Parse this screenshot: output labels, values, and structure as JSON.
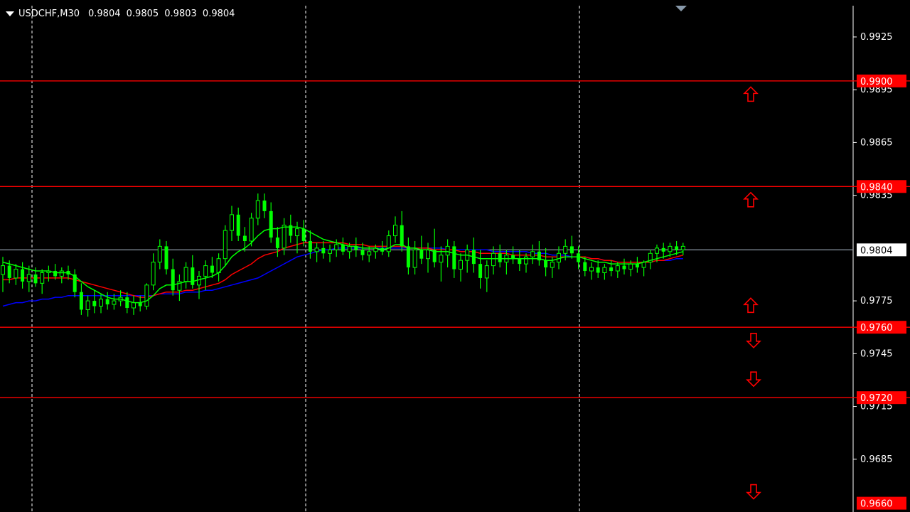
{
  "header": {
    "symbol": "USDCHF,M30",
    "open": "0.9804",
    "high": "0.9805",
    "low": "0.9803",
    "close": "0.9804"
  },
  "chart_data": {
    "type": "candlestick",
    "ylim": [
      0.9655,
      0.9946
    ],
    "price_axis_ticks": [
      "0.9925",
      "0.9895",
      "0.9865",
      "0.9835",
      "0.9775",
      "0.9745",
      "0.9715",
      "0.9685"
    ],
    "current_price": "0.9804",
    "current_price_color": "#ffffff",
    "levels": [
      {
        "price": "0.9900",
        "color": "#ff0000"
      },
      {
        "price": "0.9840",
        "color": "#ff0000"
      },
      {
        "price": "0.9760",
        "color": "#ff0000"
      },
      {
        "price": "0.9720",
        "color": "#ff0000"
      }
    ],
    "bottom_cut_label": "0.9660",
    "arrows": [
      {
        "price": 0.98925,
        "direction": "up"
      },
      {
        "price": 0.98325,
        "direction": "up"
      },
      {
        "price": 0.97725,
        "direction": "up"
      },
      {
        "price": 0.97525,
        "direction": "down"
      },
      {
        "price": 0.97305,
        "direction": "down"
      },
      {
        "price": 0.96665,
        "direction": "down"
      }
    ],
    "candle_color": "#00ff00",
    "ma_colors": {
      "fast": "#00ff00",
      "medium": "#ff0000",
      "slow": "#0000ff"
    },
    "grid": "vertical-dashed",
    "ohlc": [
      [
        0.979,
        0.98,
        0.978,
        0.9795
      ],
      [
        0.9795,
        0.9798,
        0.9785,
        0.9788
      ],
      [
        0.9788,
        0.9796,
        0.9784,
        0.9793
      ],
      [
        0.9793,
        0.9797,
        0.9782,
        0.9786
      ],
      [
        0.9786,
        0.9795,
        0.978,
        0.979
      ],
      [
        0.979,
        0.9794,
        0.9783,
        0.9785
      ],
      [
        0.9785,
        0.9793,
        0.9779,
        0.9791
      ],
      [
        0.9791,
        0.9795,
        0.9786,
        0.9792
      ],
      [
        0.9792,
        0.9796,
        0.9787,
        0.9789
      ],
      [
        0.9789,
        0.9794,
        0.9785,
        0.9792
      ],
      [
        0.9792,
        0.9795,
        0.9787,
        0.979
      ],
      [
        0.979,
        0.9793,
        0.9777,
        0.978
      ],
      [
        0.978,
        0.9785,
        0.9767,
        0.977
      ],
      [
        0.977,
        0.9778,
        0.9766,
        0.9775
      ],
      [
        0.9775,
        0.9781,
        0.9768,
        0.9772
      ],
      [
        0.9772,
        0.9779,
        0.9768,
        0.9776
      ],
      [
        0.9776,
        0.978,
        0.977,
        0.9773
      ],
      [
        0.9773,
        0.9779,
        0.977,
        0.9775
      ],
      [
        0.9775,
        0.9781,
        0.9772,
        0.9777
      ],
      [
        0.9777,
        0.978,
        0.9768,
        0.9771
      ],
      [
        0.9771,
        0.9778,
        0.9767,
        0.9774
      ],
      [
        0.9774,
        0.9778,
        0.9769,
        0.9772
      ],
      [
        0.9772,
        0.9785,
        0.977,
        0.9784
      ],
      [
        0.9784,
        0.9802,
        0.9781,
        0.9797
      ],
      [
        0.9797,
        0.981,
        0.9793,
        0.9806
      ],
      [
        0.9806,
        0.9809,
        0.979,
        0.9793
      ],
      [
        0.9793,
        0.9799,
        0.9778,
        0.9781
      ],
      [
        0.9781,
        0.979,
        0.9775,
        0.9786
      ],
      [
        0.9786,
        0.9797,
        0.9782,
        0.9794
      ],
      [
        0.9794,
        0.9801,
        0.9782,
        0.9784
      ],
      [
        0.9784,
        0.9792,
        0.9776,
        0.9789
      ],
      [
        0.9789,
        0.9798,
        0.9781,
        0.9795
      ],
      [
        0.9795,
        0.98,
        0.9788,
        0.9791
      ],
      [
        0.9791,
        0.9802,
        0.9786,
        0.9799
      ],
      [
        0.9799,
        0.9818,
        0.9795,
        0.9815
      ],
      [
        0.9815,
        0.9829,
        0.9809,
        0.9824
      ],
      [
        0.9824,
        0.9828,
        0.9809,
        0.9812
      ],
      [
        0.9812,
        0.9817,
        0.9803,
        0.9809
      ],
      [
        0.9809,
        0.9825,
        0.9806,
        0.9822
      ],
      [
        0.9822,
        0.9836,
        0.9818,
        0.9832
      ],
      [
        0.9832,
        0.9836,
        0.9822,
        0.9826
      ],
      [
        0.9826,
        0.9831,
        0.9808,
        0.9811
      ],
      [
        0.9811,
        0.9817,
        0.98,
        0.9805
      ],
      [
        0.9805,
        0.9822,
        0.9801,
        0.9818
      ],
      [
        0.9818,
        0.9824,
        0.9808,
        0.9812
      ],
      [
        0.9812,
        0.982,
        0.9802,
        0.9816
      ],
      [
        0.9816,
        0.9821,
        0.9806,
        0.9809
      ],
      [
        0.9809,
        0.9815,
        0.9799,
        0.9803
      ],
      [
        0.9803,
        0.9808,
        0.9797,
        0.9805
      ],
      [
        0.9805,
        0.9809,
        0.9799,
        0.9802
      ],
      [
        0.9802,
        0.9807,
        0.9797,
        0.9804
      ],
      [
        0.9804,
        0.981,
        0.98,
        0.9807
      ],
      [
        0.9807,
        0.9811,
        0.9801,
        0.9803
      ],
      [
        0.9803,
        0.9808,
        0.9799,
        0.9806
      ],
      [
        0.9806,
        0.9811,
        0.98,
        0.9804
      ],
      [
        0.9804,
        0.9808,
        0.9798,
        0.9801
      ],
      [
        0.9801,
        0.9806,
        0.9797,
        0.9803
      ],
      [
        0.9803,
        0.9807,
        0.9799,
        0.9805
      ],
      [
        0.9805,
        0.9809,
        0.9801,
        0.9803
      ],
      [
        0.9803,
        0.9815,
        0.98,
        0.9812
      ],
      [
        0.9812,
        0.9823,
        0.9808,
        0.9818
      ],
      [
        0.9818,
        0.9826,
        0.9803,
        0.9806
      ],
      [
        0.9806,
        0.9811,
        0.979,
        0.9794
      ],
      [
        0.9794,
        0.9809,
        0.979,
        0.9804
      ],
      [
        0.9804,
        0.9812,
        0.9796,
        0.9799
      ],
      [
        0.9799,
        0.9808,
        0.9791,
        0.9804
      ],
      [
        0.9804,
        0.9816,
        0.9794,
        0.9797
      ],
      [
        0.9797,
        0.9806,
        0.9786,
        0.9801
      ],
      [
        0.9801,
        0.981,
        0.9794,
        0.9806
      ],
      [
        0.9806,
        0.9809,
        0.9788,
        0.9793
      ],
      [
        0.9793,
        0.9802,
        0.9786,
        0.9798
      ],
      [
        0.9798,
        0.9807,
        0.9791,
        0.9804
      ],
      [
        0.9804,
        0.9811,
        0.9791,
        0.9796
      ],
      [
        0.9796,
        0.9804,
        0.9782,
        0.9788
      ],
      [
        0.9788,
        0.9798,
        0.978,
        0.9795
      ],
      [
        0.9795,
        0.9806,
        0.979,
        0.9802
      ],
      [
        0.9802,
        0.9807,
        0.9794,
        0.9797
      ],
      [
        0.9797,
        0.9804,
        0.979,
        0.9801
      ],
      [
        0.9801,
        0.9806,
        0.9796,
        0.9799
      ],
      [
        0.9799,
        0.9804,
        0.9792,
        0.9796
      ],
      [
        0.9796,
        0.9802,
        0.9791,
        0.98
      ],
      [
        0.98,
        0.9807,
        0.9796,
        0.9803
      ],
      [
        0.9803,
        0.9809,
        0.9795,
        0.9798
      ],
      [
        0.9798,
        0.9805,
        0.9789,
        0.9794
      ],
      [
        0.9794,
        0.98,
        0.9788,
        0.9797
      ],
      [
        0.9797,
        0.9806,
        0.9793,
        0.9802
      ],
      [
        0.9802,
        0.981,
        0.9798,
        0.9806
      ],
      [
        0.9806,
        0.9812,
        0.9799,
        0.9802
      ],
      [
        0.9802,
        0.9806,
        0.9793,
        0.9797
      ],
      [
        0.9797,
        0.98,
        0.9789,
        0.9792
      ],
      [
        0.9792,
        0.9797,
        0.9787,
        0.9794
      ],
      [
        0.9794,
        0.9798,
        0.9788,
        0.9791
      ],
      [
        0.9791,
        0.9796,
        0.9787,
        0.9794
      ],
      [
        0.9794,
        0.9798,
        0.9789,
        0.9792
      ],
      [
        0.9792,
        0.9797,
        0.9788,
        0.9795
      ],
      [
        0.9795,
        0.9799,
        0.979,
        0.9793
      ],
      [
        0.9793,
        0.9798,
        0.9789,
        0.9796
      ],
      [
        0.9796,
        0.98,
        0.9791,
        0.9794
      ],
      [
        0.9794,
        0.9798,
        0.9789,
        0.9797
      ],
      [
        0.9797,
        0.9804,
        0.9793,
        0.9802
      ],
      [
        0.9802,
        0.9807,
        0.9797,
        0.9805
      ],
      [
        0.9805,
        0.9808,
        0.9799,
        0.9803
      ],
      [
        0.9803,
        0.9808,
        0.98,
        0.9806
      ],
      [
        0.9806,
        0.9809,
        0.9801,
        0.9804
      ],
      [
        0.9804,
        0.9808,
        0.9801,
        0.9806
      ]
    ],
    "ma_fast": [
      0.9797,
      0.9796,
      0.9795,
      0.9794,
      0.9793,
      0.9792,
      0.9792,
      0.9792,
      0.9791,
      0.9791,
      0.9791,
      0.9789,
      0.9786,
      0.9783,
      0.9781,
      0.9779,
      0.9777,
      0.9776,
      0.9776,
      0.9775,
      0.9774,
      0.9774,
      0.9775,
      0.9778,
      0.9782,
      0.9784,
      0.9784,
      0.9785,
      0.9786,
      0.9786,
      0.9787,
      0.9788,
      0.9789,
      0.9791,
      0.9795,
      0.98,
      0.9803,
      0.9805,
      0.9808,
      0.9812,
      0.9815,
      0.9816,
      0.9816,
      0.9817,
      0.9817,
      0.9817,
      0.9816,
      0.9814,
      0.9812,
      0.981,
      0.9809,
      0.9808,
      0.9807,
      0.9806,
      0.9806,
      0.9805,
      0.9805,
      0.9805,
      0.9804,
      0.9805,
      0.9807,
      0.9807,
      0.9805,
      0.9805,
      0.9804,
      0.9804,
      0.9803,
      0.9803,
      0.9803,
      0.9802,
      0.9801,
      0.9801,
      0.98,
      0.9799,
      0.9799,
      0.9799,
      0.9799,
      0.9799,
      0.9799,
      0.9799,
      0.9799,
      0.9799,
      0.9799,
      0.9798,
      0.9798,
      0.9799,
      0.98,
      0.98,
      0.98,
      0.9799,
      0.9798,
      0.9797,
      0.9797,
      0.9796,
      0.9796,
      0.9796,
      0.9796,
      0.9796,
      0.9797,
      0.9798,
      0.9799,
      0.98,
      0.9801,
      0.9802,
      0.9803
    ],
    "ma_medium": [
      0.9787,
      0.9787,
      0.9788,
      0.9788,
      0.9788,
      0.9788,
      0.9788,
      0.9788,
      0.9788,
      0.9788,
      0.9788,
      0.9787,
      0.9786,
      0.9785,
      0.9784,
      0.9783,
      0.9782,
      0.9781,
      0.978,
      0.9779,
      0.9778,
      0.9777,
      0.9777,
      0.9778,
      0.9779,
      0.978,
      0.978,
      0.978,
      0.9781,
      0.9781,
      0.9782,
      0.9783,
      0.9784,
      0.9785,
      0.9787,
      0.979,
      0.9792,
      0.9794,
      0.9796,
      0.9799,
      0.9801,
      0.9802,
      0.9803,
      0.9805,
      0.9806,
      0.9807,
      0.9808,
      0.9808,
      0.9808,
      0.9808,
      0.9808,
      0.9808,
      0.9808,
      0.9807,
      0.9807,
      0.9807,
      0.9806,
      0.9806,
      0.9806,
      0.9806,
      0.9806,
      0.9806,
      0.9805,
      0.9805,
      0.9805,
      0.9805,
      0.9804,
      0.9804,
      0.9804,
      0.9804,
      0.9803,
      0.9803,
      0.9803,
      0.9802,
      0.9802,
      0.9802,
      0.9802,
      0.9802,
      0.9801,
      0.9801,
      0.9801,
      0.9801,
      0.9801,
      0.98,
      0.98,
      0.98,
      0.98,
      0.98,
      0.98,
      0.98,
      0.9799,
      0.9799,
      0.9798,
      0.9798,
      0.9797,
      0.9797,
      0.9797,
      0.9797,
      0.9797,
      0.9797,
      0.9798,
      0.9798,
      0.9799,
      0.98,
      0.9801
    ],
    "ma_slow": [
      0.9772,
      0.9773,
      0.9774,
      0.9774,
      0.9775,
      0.9775,
      0.9776,
      0.9776,
      0.9777,
      0.9777,
      0.9778,
      0.9778,
      0.9778,
      0.9778,
      0.9778,
      0.9778,
      0.9778,
      0.9778,
      0.9778,
      0.9778,
      0.9778,
      0.9778,
      0.9778,
      0.9778,
      0.9779,
      0.9779,
      0.9779,
      0.9779,
      0.978,
      0.978,
      0.978,
      0.9781,
      0.9781,
      0.9782,
      0.9783,
      0.9784,
      0.9785,
      0.9786,
      0.9787,
      0.9788,
      0.979,
      0.9792,
      0.9794,
      0.9796,
      0.9798,
      0.98,
      0.9801,
      0.9802,
      0.9803,
      0.9804,
      0.9804,
      0.9805,
      0.9805,
      0.9805,
      0.9805,
      0.9805,
      0.9805,
      0.9805,
      0.9805,
      0.9805,
      0.9805,
      0.9805,
      0.9805,
      0.9805,
      0.9805,
      0.9805,
      0.9805,
      0.9805,
      0.9804,
      0.9804,
      0.9804,
      0.9804,
      0.9804,
      0.9804,
      0.9804,
      0.9803,
      0.9803,
      0.9803,
      0.9803,
      0.9803,
      0.9803,
      0.9802,
      0.9802,
      0.9802,
      0.9801,
      0.9801,
      0.9801,
      0.98,
      0.98,
      0.98,
      0.9799,
      0.9799,
      0.9798,
      0.9798,
      0.9797,
      0.9797,
      0.9797,
      0.9797,
      0.9797,
      0.9797,
      0.9798,
      0.9798,
      0.9798,
      0.9799,
      0.9799
    ]
  }
}
